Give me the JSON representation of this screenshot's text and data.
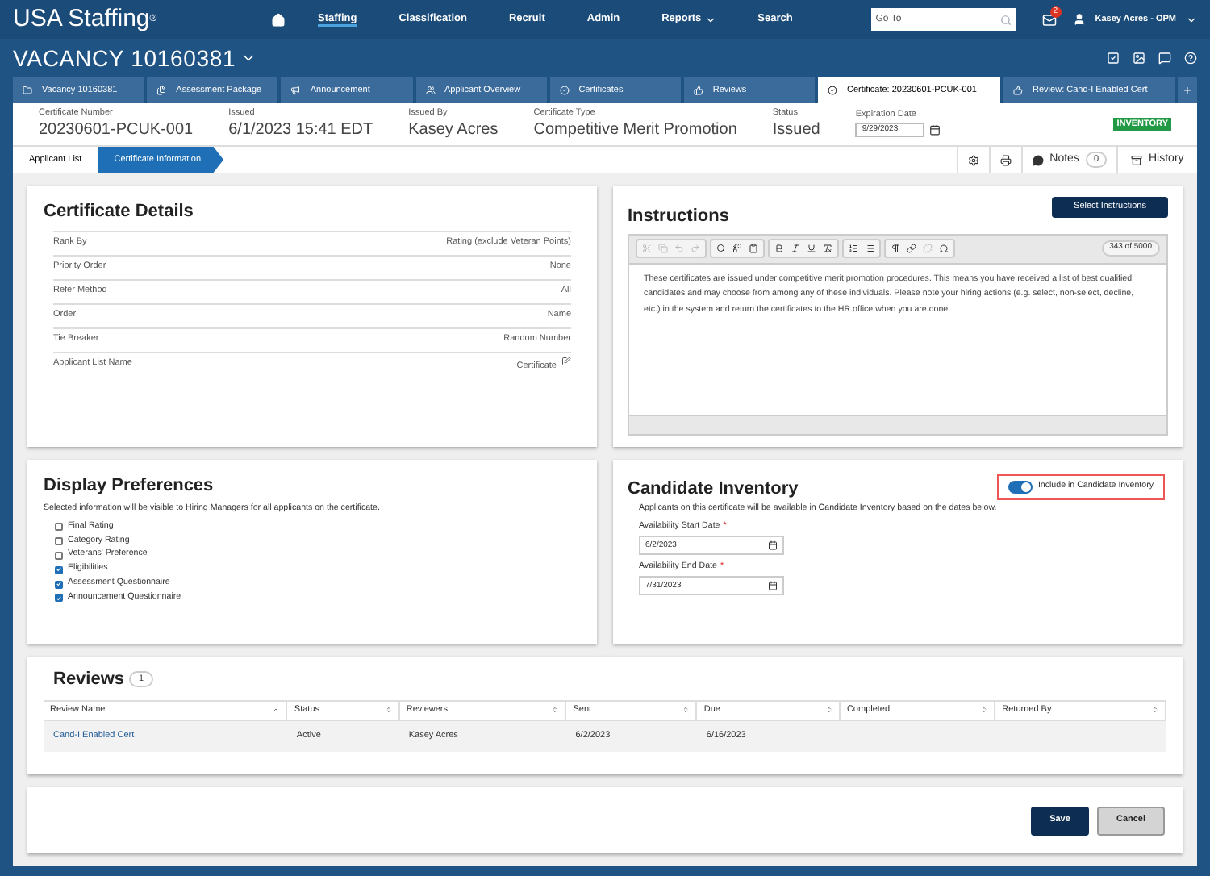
{
  "brand": "USA Staffing$^{®}$",
  "nav": [
    {
      "label": "Staffing",
      "selected": true,
      "dropdown": false
    },
    {
      "label": "Classification",
      "selected": false,
      "dropdown": false
    },
    {
      "label": "Recruit",
      "selected": false,
      "dropdown": false
    },
    {
      "label": "Admin",
      "selected": false,
      "dropdown": false
    },
    {
      "label": "Reports",
      "selected": false,
      "dropdown": true
    },
    {
      "label": "Search",
      "selected": false,
      "dropdown": false
    }
  ],
  "goto": {
    "placeholder": "Go To"
  },
  "mail_badge": "2",
  "user": "Kasey Acres - OPM",
  "vacancy_title": "VACANCY 10160381",
  "tabs": [
    {
      "label": "Vacancy 10160381",
      "selected": false
    },
    {
      "label": "Assessment Package",
      "selected": false
    },
    {
      "label": "Announcement",
      "selected": false
    },
    {
      "label": "Applicant Overview",
      "selected": false
    },
    {
      "label": "Certificates",
      "selected": false
    },
    {
      "label": "Reviews",
      "selected": false
    },
    {
      "label": "Certificate: 20230601-PCUK-001",
      "selected": true
    },
    {
      "label": "Review: Cand-I Enabled Cert",
      "selected": false
    }
  ],
  "header": [
    {
      "label": "Certificate Number",
      "value": "20230601-PCUK-001",
      "kind": "text"
    },
    {
      "label": "Issued",
      "value": "6/1/2023 15:41 EDT",
      "kind": "text"
    },
    {
      "label": "Issued By",
      "value": "Kasey Acres",
      "kind": "text"
    },
    {
      "label": "Certificate Type",
      "value": "Competitive Merit Promotion",
      "kind": "text"
    },
    {
      "label": "Status",
      "value": "Issued",
      "kind": "text"
    },
    {
      "label": "Expiration Date",
      "value": "9/29/2023",
      "kind": "date"
    }
  ],
  "inventory_badge": "INVENTORY",
  "breadcrumbs": [
    {
      "label": "Applicant List",
      "selected": false
    },
    {
      "label": "Certificate Information",
      "selected": true
    }
  ],
  "notes": {
    "label": "Notes",
    "count": "0"
  },
  "history": "History",
  "certificate_details": {
    "title": "Certificate Details",
    "rows": [
      {
        "label": "Rank By",
        "value": "Rating (exclude Veteran Points)",
        "editable": false
      },
      {
        "label": "Priority Order",
        "value": "None",
        "editable": false
      },
      {
        "label": "Refer Method",
        "value": "All",
        "editable": false
      },
      {
        "label": "Order",
        "value": "Name",
        "editable": false
      },
      {
        "label": "Tie Breaker",
        "value": "Random Number",
        "editable": false
      },
      {
        "label": "Applicant List Name",
        "value": "Certificate",
        "editable": true
      }
    ]
  },
  "instructions": {
    "title": "Instructions",
    "button": "Select Instructions",
    "char_count": "343 of 5000",
    "text": "These certificates are issued under competitive merit promotion procedures. This means you have received a list of best qualified candidates and may choose from among any of these individuals. Please note your hiring actions (e.g. select, non-select, decline, etc.) in the system and return the certificates to the HR office when you are done."
  },
  "display_preferences": {
    "title": "Display Preferences",
    "description": "Selected information will be visible to Hiring Managers for all applicants on the certificate.",
    "options": [
      {
        "label": "Final Rating",
        "checked": false
      },
      {
        "label": "Category Rating",
        "checked": false
      },
      {
        "label": "Veterans' Preference",
        "checked": false
      },
      {
        "label": "Eligibilities",
        "checked": true
      },
      {
        "label": "Assessment Questionnaire",
        "checked": true
      },
      {
        "label": "Announcement Questionnaire",
        "checked": true
      }
    ]
  },
  "candidate_inventory": {
    "title": "Candidate Inventory",
    "toggle": {
      "label": "Include in Candidate Inventory",
      "on": true
    },
    "description": "Applicants on this certificate will be available in Candidate Inventory based on the dates below.",
    "dates": [
      {
        "label": "Availability Start Date",
        "required_marker": "*",
        "value": "6/2/2023"
      },
      {
        "label": "Availability End Date",
        "required_marker": "*",
        "value": "7/31/2023"
      }
    ]
  },
  "reviews": {
    "title": "Reviews",
    "count": "1",
    "columns": [
      "Review Name",
      "Status",
      "Reviewers",
      "Sent",
      "Due",
      "Completed",
      "Returned By"
    ],
    "rows": [
      [
        "Cand-I Enabled Cert",
        "Active",
        "Kasey Acres",
        "6/2/2023",
        "6/16/2023",
        "",
        ""
      ]
    ]
  },
  "actions": [
    {
      "label": "Save",
      "kind": "primary"
    },
    {
      "label": "Cancel",
      "kind": "secondary"
    }
  ]
}
